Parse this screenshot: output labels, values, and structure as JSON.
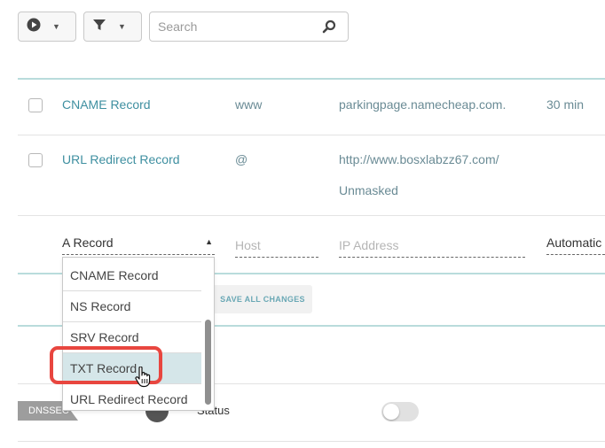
{
  "toolbar": {
    "play_filter_icon": "play-circle-icon",
    "filter_icon": "funnel-icon",
    "search_placeholder": "Search",
    "search_value": ""
  },
  "records": [
    {
      "type": "CNAME Record",
      "host": "www",
      "value": "parkingpage.namecheap.com.",
      "ttl": "30 min"
    },
    {
      "type": "URL Redirect Record",
      "host": "@",
      "value": "http://www.bosxlabzz67.com/",
      "mode": "Unmasked"
    }
  ],
  "new_record": {
    "selected_type": "A Record",
    "host_placeholder": "Host",
    "value_placeholder": "IP Address",
    "ttl": "Automatic"
  },
  "type_options": [
    "CNAME Record",
    "NS Record",
    "SRV Record",
    "TXT Record",
    "URL Redirect Record"
  ],
  "highlighted_option_index": 3,
  "actions": {
    "save_all": "SAVE ALL CHANGES"
  },
  "dnssec": {
    "badge": "DNSSEC",
    "status_label": "Status",
    "enabled": false
  },
  "colors": {
    "accent": "#3e8fa0",
    "highlight": "#e8463f",
    "selected_row": "#d5e6e9"
  }
}
